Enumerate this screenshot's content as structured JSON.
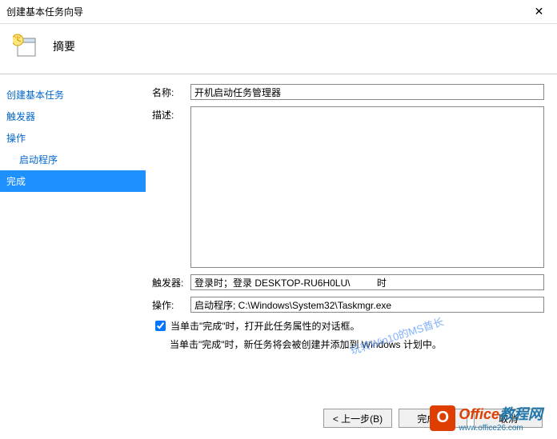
{
  "window": {
    "title": "创建基本任务向导",
    "close_label": "✕"
  },
  "header": {
    "heading": "摘要"
  },
  "sidebar": {
    "step_create": "创建基本任务",
    "step_trigger": "触发器",
    "step_action": "操作",
    "step_start_program": "启动程序",
    "step_finish": "完成"
  },
  "form": {
    "name_label": "名称:",
    "name_value": "开机启动任务管理器",
    "desc_label": "描述:",
    "desc_value": "",
    "trigger_label": "触发器:",
    "trigger_value": "登录时；登录 DESKTOP-RU6H0LU\\          时",
    "action_label": "操作:",
    "action_value": "启动程序; C:\\Windows\\System32\\Taskmgr.exe",
    "checkbox_label": "当单击\"完成\"时，打开此任务属性的对话框。",
    "note_text": "当单击\"完成\"时，新任务将会被创建并添加到 Windows 计划中。"
  },
  "buttons": {
    "back": "< 上一步(B)",
    "finish": "完成(F)",
    "cancel": "取消"
  },
  "watermark": {
    "diagonal": "玩转Win10的MS酋长",
    "logo": "O",
    "text1": "Office",
    "text2": "教程网",
    "sub": "www.office26.com"
  }
}
